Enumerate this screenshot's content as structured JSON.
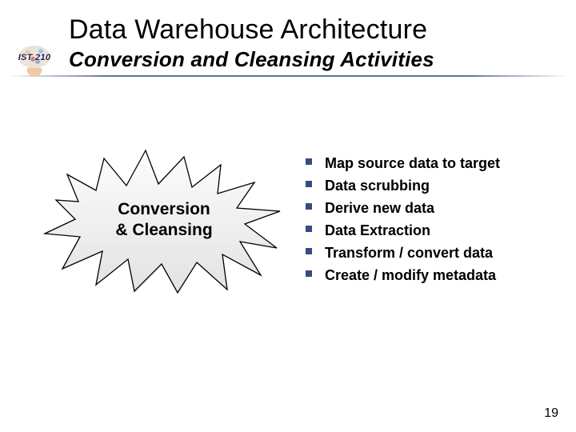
{
  "header": {
    "title": "Data Warehouse Architecture",
    "subtitle": "Conversion and Cleansing Activities",
    "badge": "IST 210"
  },
  "burst": {
    "label": "Conversion\n& Cleansing"
  },
  "bullets": [
    "Map source data to target",
    "Data scrubbing",
    "Derive new data",
    "Data Extraction",
    "Transform / convert data",
    "Create / modify metadata"
  ],
  "page_number": "19"
}
